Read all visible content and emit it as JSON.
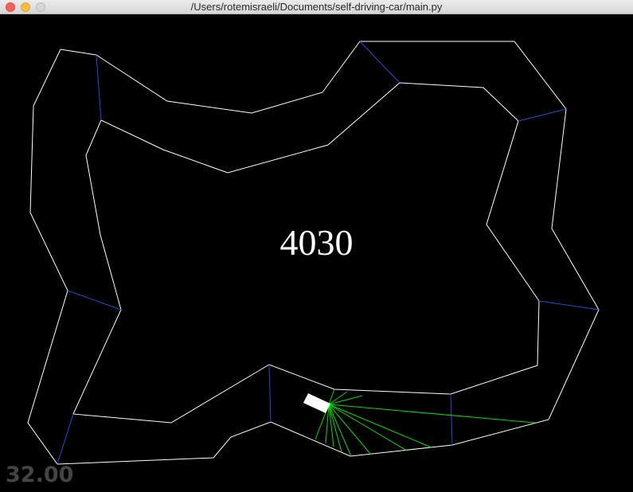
{
  "window": {
    "title": "/Users/rotemisraeli/Documents/self-driving-car/main.py"
  },
  "game": {
    "score": "4030",
    "fps": "32.00"
  },
  "colors": {
    "track": "#ffffff",
    "checkpoint": "#1f4fd8",
    "sensor": "#00e000",
    "car": "#ffffff",
    "fps_text": "#444444"
  }
}
